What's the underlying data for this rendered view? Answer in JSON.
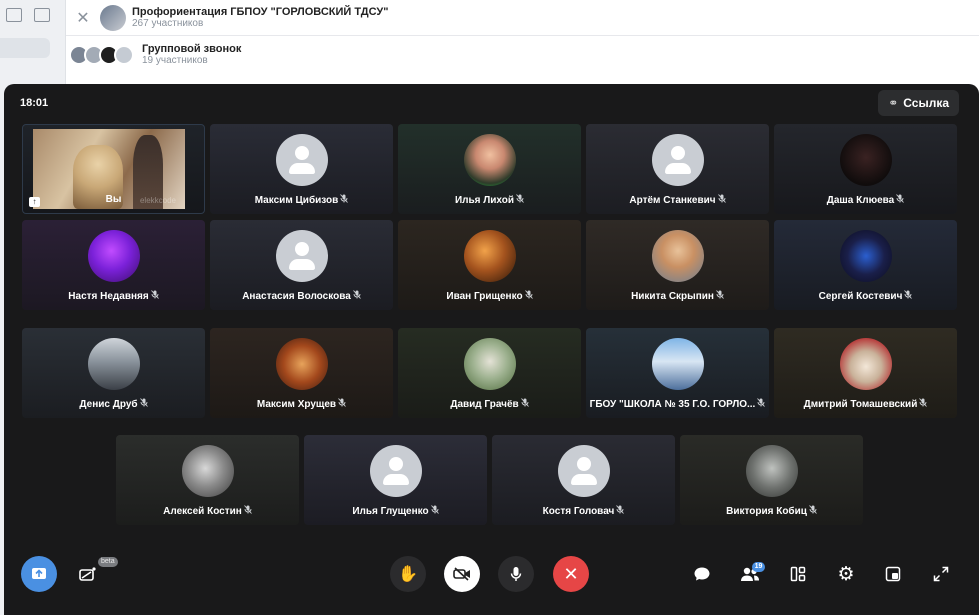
{
  "background": {
    "chat1": {
      "title": "Профориентация ГБПОУ \"ГОРЛОВСКИЙ ТДСУ\"",
      "subtitle": "267 участников"
    },
    "chat2": {
      "title": "Групповой звонок",
      "subtitle": "19 участников"
    },
    "close_glyph": "✕"
  },
  "call": {
    "time": "18:01",
    "link_label": "Ссылка",
    "participants": [
      {
        "name": "Вы",
        "self": true,
        "watermark": "elekkcode"
      },
      {
        "name": "Максим Цибизов",
        "avatar": "placeholder"
      },
      {
        "name": "Илья Лихой",
        "avatar": "photo"
      },
      {
        "name": "Артём Станкевич",
        "avatar": "placeholder"
      },
      {
        "name": "Даша Клюева",
        "avatar": "photo"
      },
      {
        "name": "Настя Недавняя",
        "avatar": "photo"
      },
      {
        "name": "Анастасия Волоскова",
        "avatar": "placeholder"
      },
      {
        "name": "Иван Грищенко",
        "avatar": "photo"
      },
      {
        "name": "Никита Скрыпин",
        "avatar": "photo"
      },
      {
        "name": "Сергей Костевич",
        "avatar": "photo"
      },
      {
        "name": "Денис Друб",
        "avatar": "photo"
      },
      {
        "name": "Максим Хрущев",
        "avatar": "photo"
      },
      {
        "name": "Давид Грачёв",
        "avatar": "photo"
      },
      {
        "name": "ГБОУ \"ШКОЛА № 35 Г.О. ГОРЛО...",
        "avatar": "photo"
      },
      {
        "name": "Дмитрий Томашевский",
        "avatar": "photo"
      },
      {
        "name": "Алексей Костин",
        "avatar": "photo"
      },
      {
        "name": "Илья Глущенко",
        "avatar": "placeholder"
      },
      {
        "name": "Костя Головач",
        "avatar": "placeholder"
      },
      {
        "name": "Виктория Кобиц",
        "avatar": "photo"
      }
    ],
    "toolbar": {
      "beta_label": "beta",
      "participants_count": "19"
    }
  },
  "icons": {
    "link": "link-icon",
    "mic_off": "mic-off-icon",
    "share_screen": "share-screen-icon",
    "effects": "effects-icon",
    "raise_hand": "raise-hand-icon",
    "camera_off": "camera-off-icon",
    "mic": "microphone-icon",
    "end_call": "end-call-icon",
    "chat": "chat-icon",
    "participants": "participants-icon",
    "layout": "layout-icon",
    "settings": "gear-icon",
    "pip": "picture-in-picture-icon",
    "fullscreen": "fullscreen-icon"
  },
  "colors": {
    "call_bg": "#19191a",
    "accent_blue": "#4a90e2",
    "end_call_red": "#e64646"
  }
}
